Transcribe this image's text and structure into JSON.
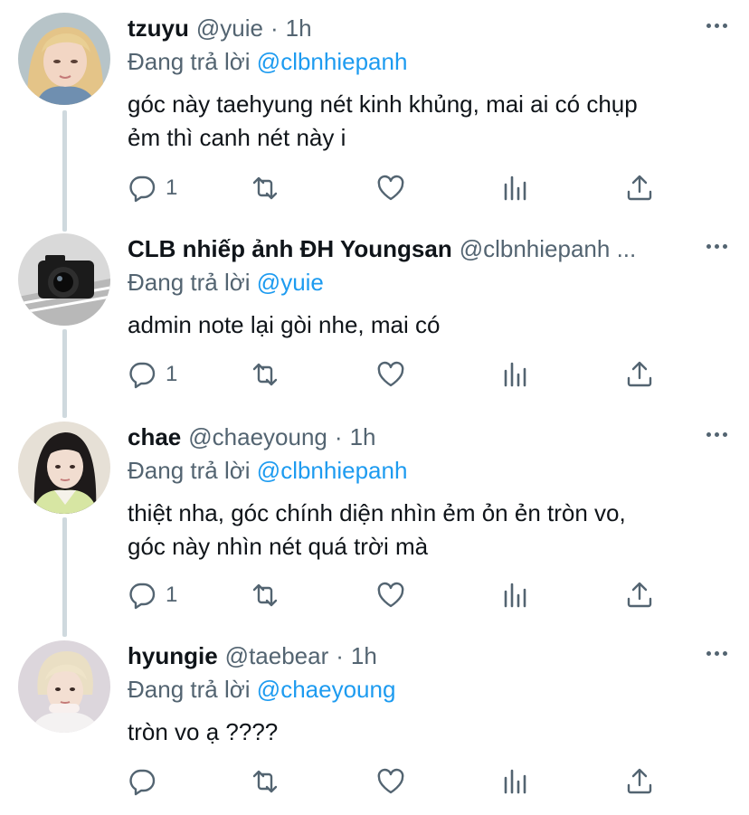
{
  "replying_prefix": "Đang trả lời",
  "colors": {
    "link": "#1d9bf0",
    "secondary": "#536471",
    "thread_line": "#cfd9de"
  },
  "tweets": [
    {
      "name": "tzuyu",
      "handle": "@yuie",
      "separator": "·",
      "time": "1h",
      "replying_to": "@clbnhiepanh",
      "text_lines": [
        "góc này taehyung nét kinh khủng, mai ai có chụp",
        "ẻm thì canh nét này i"
      ],
      "reply_count": "1",
      "avatar": "blonde-woman-avatar"
    },
    {
      "name": "CLB nhiếp ảnh ĐH Youngsan",
      "handle": "@clbnhiepanh ...",
      "separator": "",
      "time": "",
      "replying_to": "@yuie",
      "text_lines": [
        "admin note lại gòi nhe, mai có"
      ],
      "reply_count": "1",
      "avatar": "camera-avatar"
    },
    {
      "name": "chae",
      "handle": "@chaeyoung",
      "separator": "·",
      "time": "1h",
      "replying_to": "@clbnhiepanh",
      "text_lines": [
        "thiệt nha, góc chính diện nhìn ẻm ỏn ẻn tròn vo,",
        "góc này nhìn nét quá trời mà"
      ],
      "reply_count": "1",
      "avatar": "dark-hair-woman-avatar"
    },
    {
      "name": "hyungie",
      "handle": "@taebear",
      "separator": "·",
      "time": "1h",
      "replying_to": "@chaeyoung",
      "text_lines": [
        "tròn vo ạ ????"
      ],
      "reply_count": "",
      "avatar": "blond-man-avatar"
    }
  ]
}
